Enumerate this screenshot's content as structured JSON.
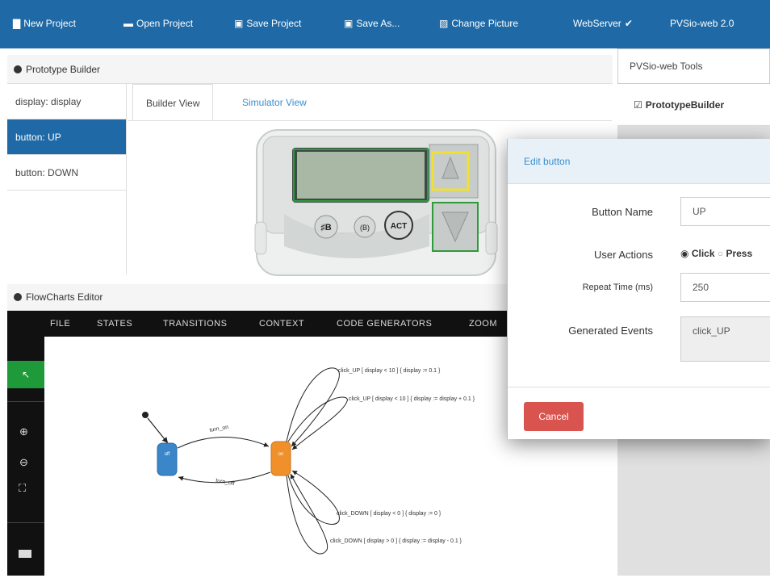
{
  "topbar": {
    "items": [
      {
        "icon": "file-icon",
        "label": "New Project"
      },
      {
        "icon": "folder-icon",
        "label": "Open Project"
      },
      {
        "icon": "save-icon",
        "label": "Save Project"
      },
      {
        "icon": "save-icon",
        "label": "Save As..."
      },
      {
        "icon": "picture-icon",
        "label": "Change Picture"
      },
      {
        "icon": "check-icon",
        "label": "WebServer"
      },
      {
        "icon": "",
        "label": "PVSio-web 2.0"
      }
    ]
  },
  "prototype_builder": {
    "title": "Prototype Builder",
    "widgets": [
      "display: display",
      "button: UP",
      "button: DOWN"
    ],
    "tabs": [
      "Builder View",
      "Simulator View"
    ]
  },
  "right_panel": {
    "title": "PVSio-web Tools",
    "item": "PrototypeBuilder"
  },
  "device": {
    "button_labels": [
      "♯B",
      "(B)",
      "ACT"
    ]
  },
  "flowcharts": {
    "title": "FlowCharts Editor",
    "menu": [
      "FILE",
      "STATES",
      "TRANSITIONS",
      "CONTEXT",
      "CODE GENERATORS",
      "ZOOM"
    ],
    "states": [
      "off",
      "on"
    ],
    "transitions": [
      "click_UP [ display < 10 ] { display := 0.1 }",
      "click_UP [ display < 10 ] { display := display + 0.1 }",
      "click_DOWN [ display < 0 ] { display := 0 }",
      "click_DOWN [ display > 0 ] { display := display - 0.1 }",
      "turn_on",
      "turn_off"
    ]
  },
  "modal": {
    "title": "Edit button",
    "fields": {
      "button_name_label": "Button Name",
      "button_name_value": "UP",
      "user_actions_label": "User Actions",
      "click_option": "Click",
      "press_option": "Press",
      "repeat_label": "Repeat Time (ms)",
      "repeat_value": "250",
      "events_label": "Generated Events",
      "events_value": "click_UP"
    },
    "cancel_label": "Cancel"
  },
  "colors": {
    "topbar": "#1f6aa6",
    "active_item": "#1f6aa6",
    "state_off": "#3a86c8",
    "state_on": "#f0902a",
    "cancel": "#d9534f",
    "toolbar": "#111111"
  }
}
